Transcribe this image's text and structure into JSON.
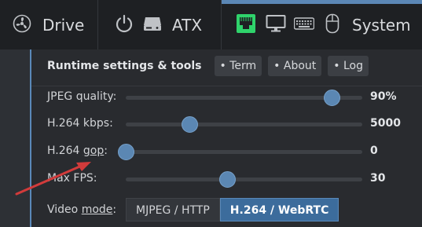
{
  "topbar": {
    "drive_label": "Drive",
    "atx_label": "ATX",
    "system_label": "System"
  },
  "panel": {
    "title": "Runtime settings & tools",
    "buttons": [
      "• Term",
      "• About",
      "• Log"
    ]
  },
  "settings": {
    "jpeg_quality": {
      "label": "JPEG quality:",
      "value": "90%",
      "fraction": 0.87
    },
    "h264_kbps": {
      "label": "H.264 kbps:",
      "value": "5000",
      "fraction": 0.27
    },
    "h264_gop": {
      "label_prefix": "H.264 ",
      "label_underlined": "gop",
      "label_suffix": ":",
      "value": "0",
      "fraction": 0.0
    },
    "max_fps": {
      "label": "Max FPS:",
      "value": "30",
      "fraction": 0.43
    },
    "video_mode": {
      "label_prefix": "Video ",
      "label_underlined": "mode",
      "label_suffix": ":",
      "options": [
        "MJPEG / HTTP",
        "H.264 / WebRTC"
      ],
      "selected": "H.264 / WebRTC"
    }
  },
  "colors": {
    "accent": "#5b87b5",
    "active_mode": "#3c6c9c",
    "lan_icon": "#2fd36b",
    "arrow": "#d23b3b"
  },
  "icons": [
    "fan-icon",
    "power-icon",
    "drive-icon",
    "network-icon",
    "monitor-icon",
    "keyboard-icon",
    "mouse-icon",
    "annotation-arrow-icon"
  ]
}
